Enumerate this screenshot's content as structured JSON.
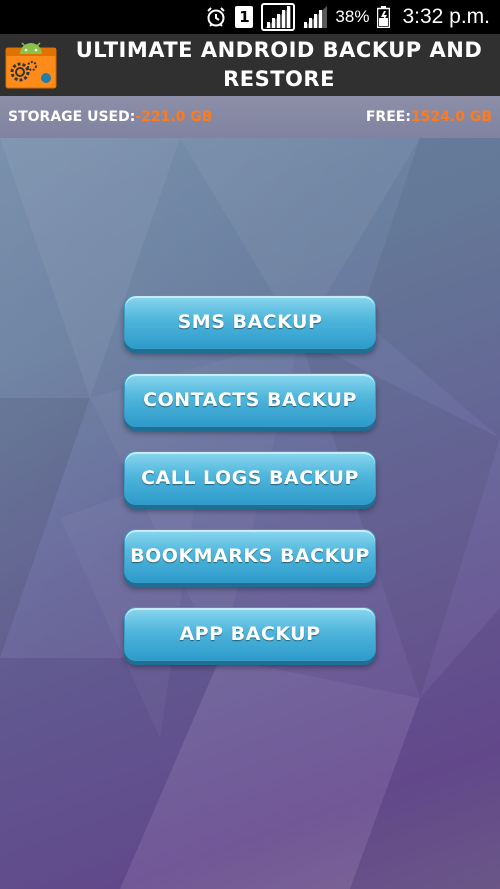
{
  "status_bar": {
    "sim_slot": "1",
    "battery_percent": "38%",
    "time": "3:32 p.m.",
    "icons": [
      "alarm-icon",
      "sim-icon",
      "signal-icon",
      "signal-icon",
      "battery-icon"
    ]
  },
  "header": {
    "title": "ULTIMATE ANDROID BACKUP AND RESTORE",
    "logo_icon": "app-logo-icon"
  },
  "storage": {
    "used_label": "STORAGE USED:",
    "used_value": "-221.0 GB",
    "free_label": "FREE:",
    "free_value": "1524.0 GB"
  },
  "menu": {
    "sms": "SMS BACKUP",
    "contacts": "CONTACTS BACKUP",
    "call_logs": "CALL LOGS BACKUP",
    "bookmarks": "BOOKMARKS BACKUP",
    "app": "APP BACKUP"
  },
  "colors": {
    "header_bg": "#303030",
    "accent_orange": "#ff7a1a",
    "button_blue": "#4fb6dc"
  }
}
